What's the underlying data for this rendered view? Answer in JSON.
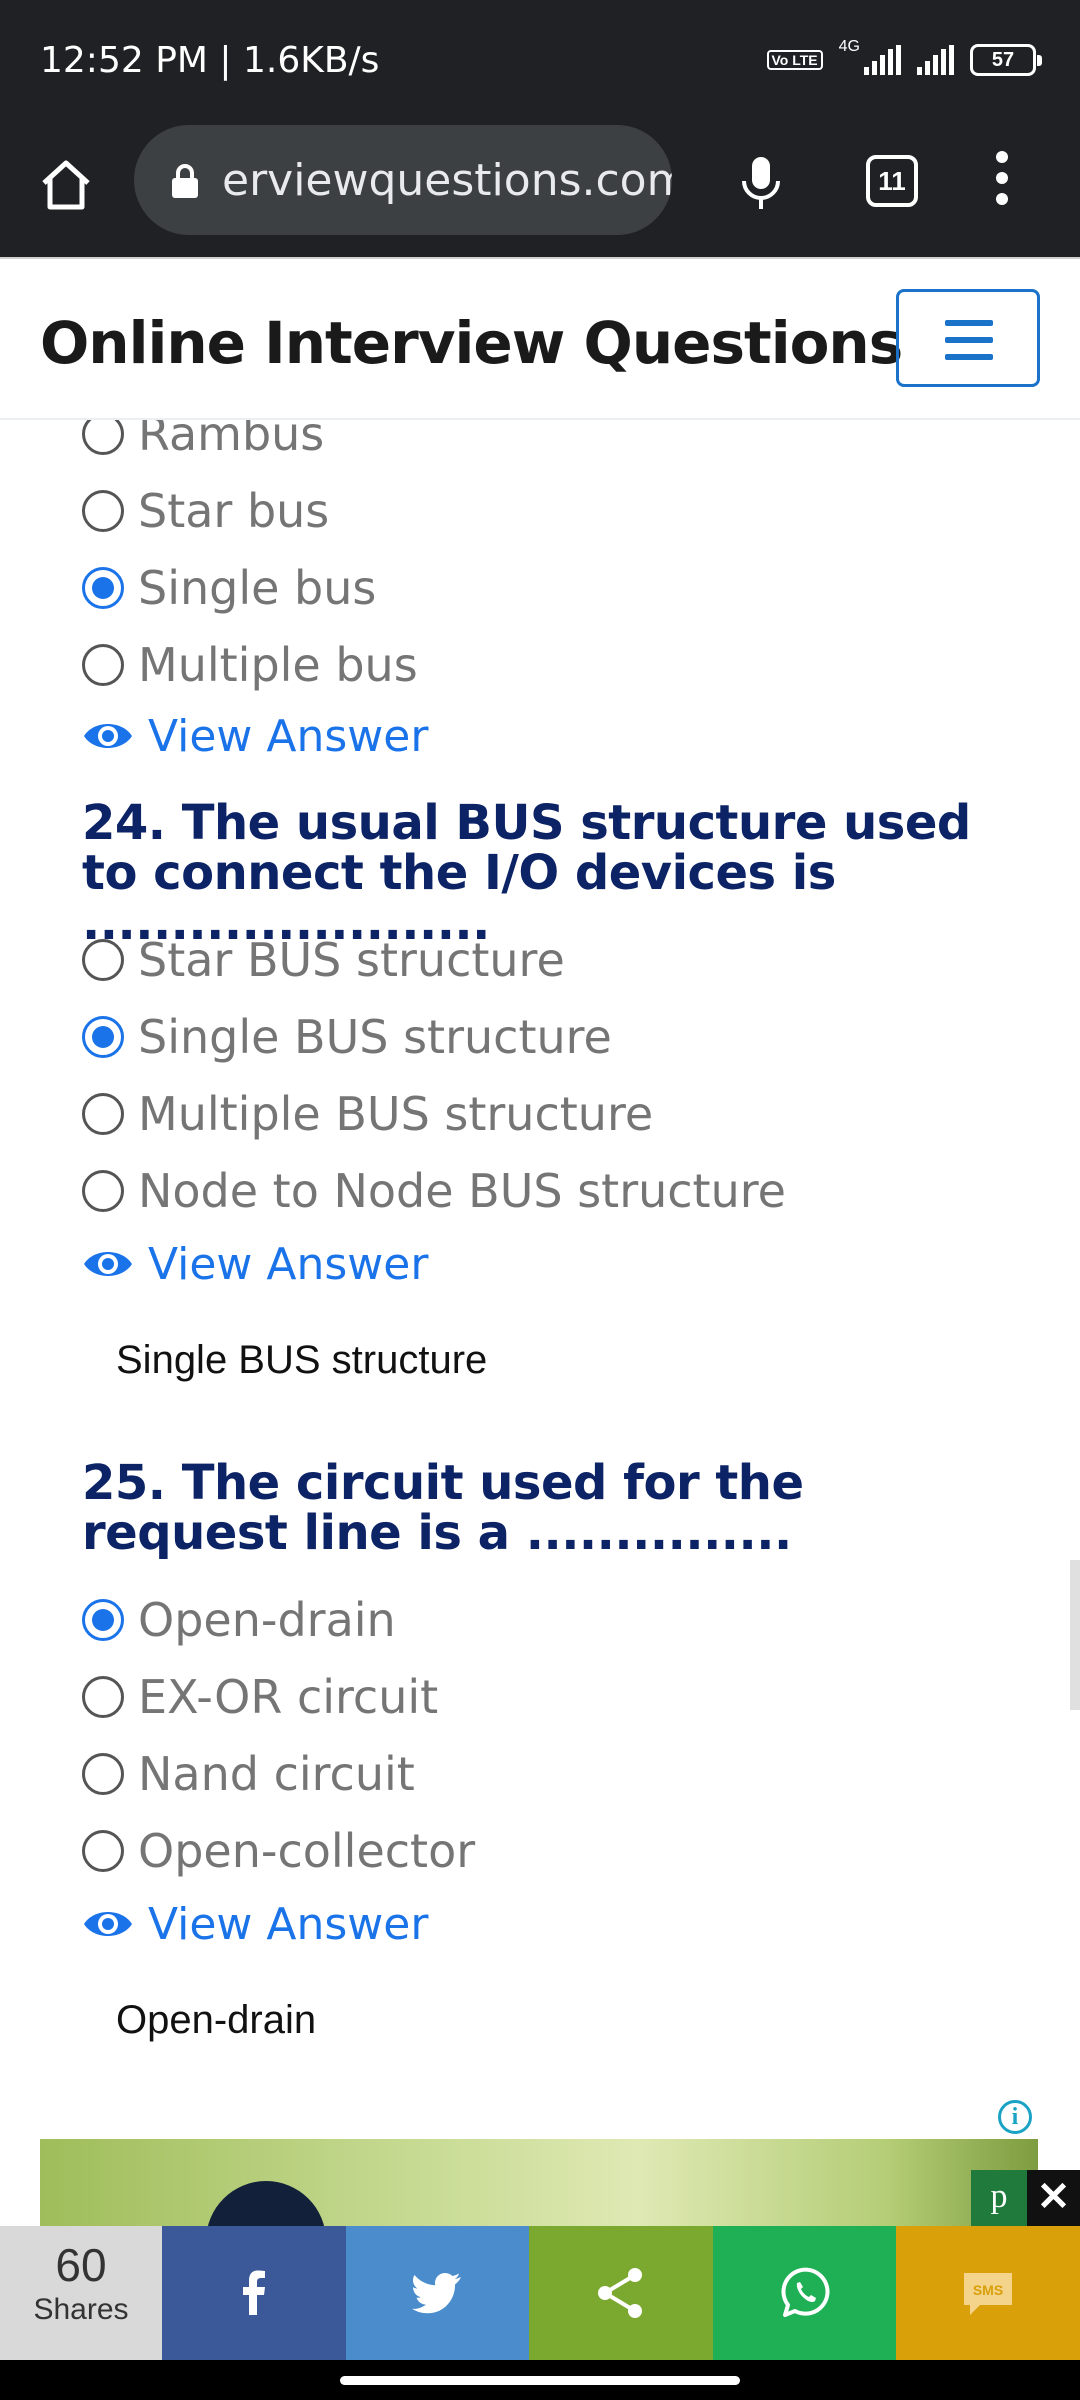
{
  "status": {
    "time": "12:52 PM | 1.6KB/s",
    "network": "4G",
    "volte": "Vo LTE",
    "battery": "57"
  },
  "browser": {
    "url": "erviewquestions.com",
    "tab_count": "11"
  },
  "site": {
    "title": "Online Interview Questions"
  },
  "q23": {
    "options": [
      {
        "label": "Rambus",
        "checked": false
      },
      {
        "label": "Star bus",
        "checked": false
      },
      {
        "label": "Single bus",
        "checked": true
      },
      {
        "label": "Multiple bus",
        "checked": false
      }
    ],
    "view_answer": "View Answer"
  },
  "q24": {
    "question": "24. The usual BUS structure used to connect the I/O devices is .......................",
    "options": [
      {
        "label": "Star BUS structure",
        "checked": false
      },
      {
        "label": "Single BUS structure",
        "checked": true
      },
      {
        "label": "Multiple BUS structure",
        "checked": false
      },
      {
        "label": "Node to Node BUS structure",
        "checked": false
      }
    ],
    "view_answer": "View Answer",
    "answer": "Single BUS structure"
  },
  "q25": {
    "question": "25. The circuit used for the request line is a ...............",
    "options": [
      {
        "label": "Open-drain",
        "checked": true
      },
      {
        "label": "EX-OR circuit",
        "checked": false
      },
      {
        "label": "Nand circuit",
        "checked": false
      },
      {
        "label": "Open-collector",
        "checked": false
      }
    ],
    "view_answer": "View Answer",
    "answer": "Open-drain"
  },
  "ad": {
    "badge": "p",
    "close": "✕",
    "info": "i"
  },
  "share": {
    "count": "60",
    "label": "Shares",
    "colors": {
      "facebook": "#3b5998",
      "twitter": "#4a8ccc",
      "share": "#7ba82e",
      "whatsapp": "#1fb055",
      "sms": "#d9a00a"
    },
    "buttons": [
      "facebook-icon",
      "twitter-icon",
      "share-icon",
      "whatsapp-icon",
      "sms-icon"
    ],
    "sms_text": "SMS"
  }
}
